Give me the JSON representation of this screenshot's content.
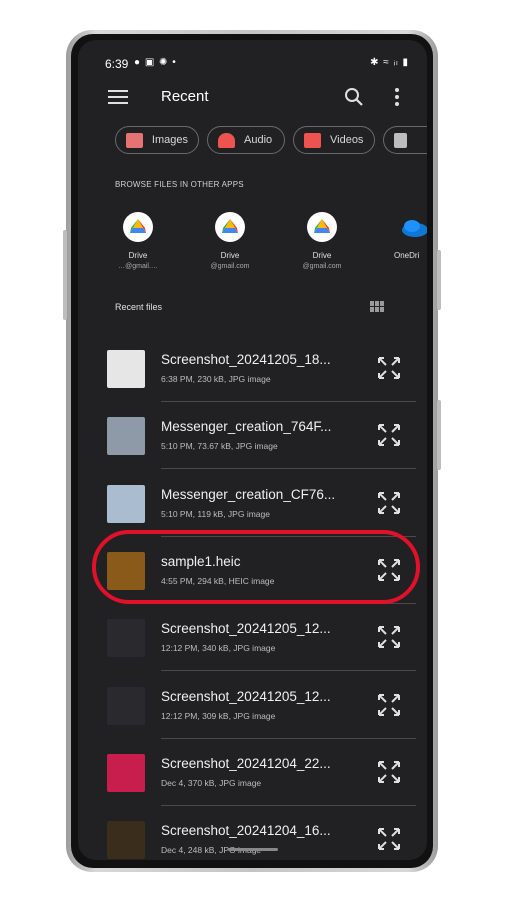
{
  "status_bar": {
    "time": "6:39",
    "notifications": "● ▣ ✺ •",
    "system": "✱ ≈ ᵢₗ ▮"
  },
  "app_bar": {
    "title": "Recent"
  },
  "chips": [
    {
      "label": "Images",
      "color": "#e57373",
      "icon": "image-icon"
    },
    {
      "label": "Audio",
      "color": "#ef5350",
      "icon": "headphones-icon"
    },
    {
      "label": "Videos",
      "color": "#ef5350",
      "icon": "video-icon"
    }
  ],
  "browse_section": {
    "label": "BROWSE FILES IN OTHER APPS"
  },
  "apps": [
    {
      "name": "Drive",
      "account": "…@gmail.…",
      "icon": "google-drive-icon"
    },
    {
      "name": "Drive",
      "account": "@gmail.com",
      "icon": "google-drive-icon"
    },
    {
      "name": "Drive",
      "account": "@gmail.com",
      "icon": "google-drive-icon"
    },
    {
      "name": "OneDri",
      "account": "",
      "icon": "onedrive-icon"
    }
  ],
  "recent": {
    "label": "Recent files"
  },
  "files": [
    {
      "name": "Screenshot_20241205_18...",
      "meta": "6:38 PM, 230 kB, JPG image",
      "thumb": "#e6e6e6"
    },
    {
      "name": "Messenger_creation_764F...",
      "meta": "5:10 PM, 73.67 kB, JPG image",
      "thumb": "#8f9aa8"
    },
    {
      "name": "Messenger_creation_CF76...",
      "meta": "5:10 PM, 119 kB, JPG image",
      "thumb": "#a9bcd0"
    },
    {
      "name": "sample1.heic",
      "meta": "4:55 PM, 294 kB, HEIC image",
      "thumb": "#8a5a1a"
    },
    {
      "name": "Screenshot_20241205_12...",
      "meta": "12:12 PM, 340 kB, JPG image",
      "thumb": "#2a2a2e"
    },
    {
      "name": "Screenshot_20241205_12...",
      "meta": "12:12 PM, 309 kB, JPG image",
      "thumb": "#2a2a2e"
    },
    {
      "name": "Screenshot_20241204_22...",
      "meta": "Dec 4, 370 kB, JPG image",
      "thumb": "#c81e4e"
    },
    {
      "name": "Screenshot_20241204_16...",
      "meta": "Dec 4, 248 kB, JPG image",
      "thumb": "#3a2d1c"
    }
  ],
  "highlight_color": "#e3102a"
}
